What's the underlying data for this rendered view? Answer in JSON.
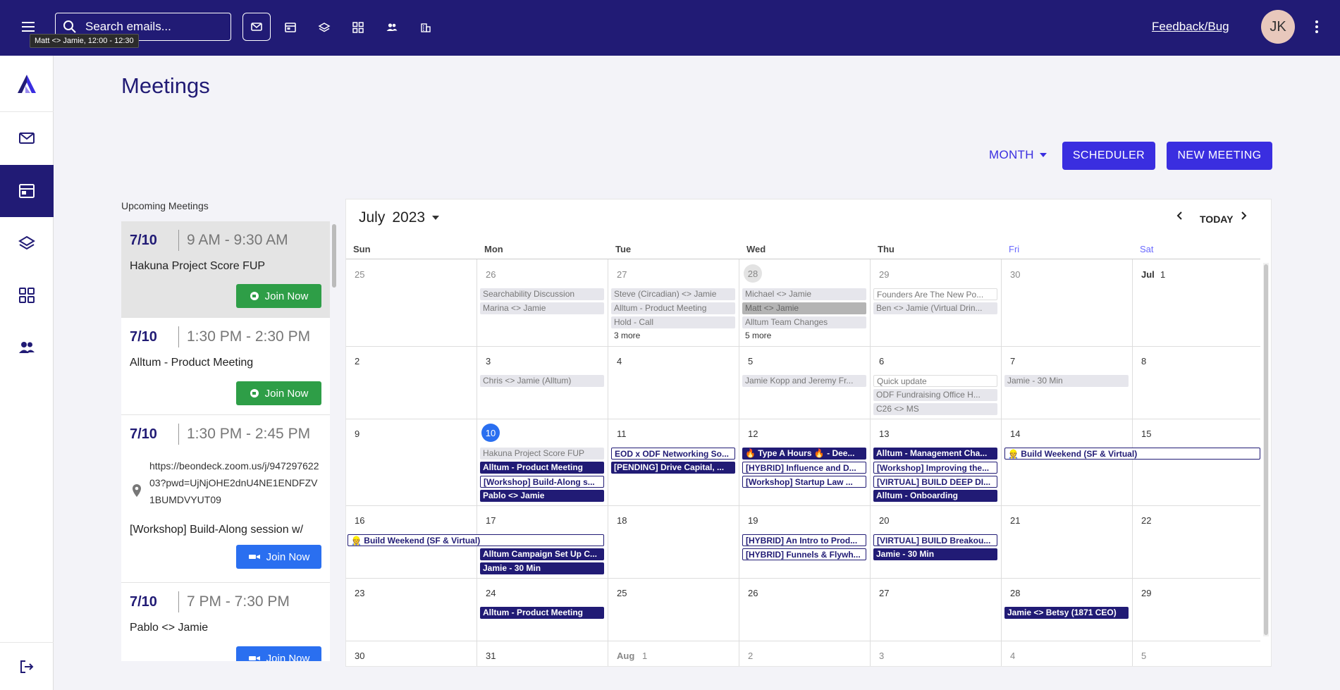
{
  "topbar": {
    "search_placeholder": "Search emails...",
    "tooltip": "Matt <> Jamie, 12:00 - 12:30",
    "feedback": "Feedback/Bug",
    "avatar_initials": "JK"
  },
  "page": {
    "title": "Meetings",
    "view_select": "MONTH",
    "scheduler_label": "SCHEDULER",
    "new_meeting_label": "NEW MEETING",
    "upcoming_label": "Upcoming Meetings"
  },
  "upcoming": [
    {
      "date": "7/10",
      "time": "9 AM - 9:30 AM",
      "title": "Hakuna Project Score FUP",
      "join": "Join Now",
      "platform": "meet"
    },
    {
      "date": "7/10",
      "time": "1:30 PM - 2:30 PM",
      "title": "Alltum - Product Meeting",
      "join": "Join Now",
      "platform": "meet"
    },
    {
      "date": "7/10",
      "time": "1:30 PM - 2:45 PM",
      "location": "https://beondeck.zoom.us/j/94729762203?pwd=UjNjOHE2dnU4NE1ENDFZV1BUMDVYUT09",
      "title": "[Workshop] Build-Along session w/",
      "join": "Join Now",
      "platform": "zoom"
    },
    {
      "date": "7/10",
      "time": "7 PM - 7:30 PM",
      "title": "Pablo <> Jamie",
      "join": "Join Now",
      "platform": "zoom"
    }
  ],
  "calendar": {
    "month": "July",
    "year": "2023",
    "today_label": "TODAY",
    "days_of_week": [
      "Sun",
      "Mon",
      "Tue",
      "Wed",
      "Thu",
      "Fri",
      "Sat"
    ],
    "weeks": [
      [
        "25",
        "26",
        "27",
        "28",
        "29",
        "30",
        "1"
      ],
      [
        "2",
        "3",
        "4",
        "5",
        "6",
        "7",
        "8"
      ],
      [
        "9",
        "10",
        "11",
        "12",
        "13",
        "14",
        "15"
      ],
      [
        "16",
        "17",
        "18",
        "19",
        "20",
        "21",
        "22"
      ],
      [
        "23",
        "24",
        "25",
        "26",
        "27",
        "28",
        "29"
      ],
      [
        "30",
        "31",
        "1",
        "2",
        "3",
        "4",
        "5"
      ]
    ],
    "month_markers": {
      "jul": "Jul",
      "aug": "Aug"
    },
    "events": {
      "w0": {
        "mon": [
          "Searchability Discussion",
          "Marina <> Jamie"
        ],
        "tue": [
          "Steve (Circadian) <> Jamie",
          "Alltum - Product Meeting",
          "Hold - Call"
        ],
        "tue_more": "3 more",
        "wed": [
          "Michael <> Jamie",
          "Matt <> Jamie",
          "Alltum Team Changes"
        ],
        "wed_more": "5 more",
        "thu": [
          "Founders Are The New Po...",
          "Ben <> Jamie (Virtual Drin..."
        ]
      },
      "w1": {
        "mon": [
          "Chris <> Jamie (Alltum)"
        ],
        "wed": [
          "Jamie Kopp and Jeremy Fr..."
        ],
        "thu": [
          "Quick update",
          "ODF Fundraising Office H...",
          "C26 <> MS"
        ],
        "fri": [
          "Jamie - 30 Min"
        ]
      },
      "w2": {
        "mon": [
          "Hakuna Project Score FUP",
          "Alltum - Product Meeting",
          "[Workshop] Build-Along s...",
          "Pablo <> Jamie"
        ],
        "tue": [
          "EOD x ODF Networking So...",
          "[PENDING] Drive Capital, ..."
        ],
        "wed": [
          "🔥 Type A Hours 🔥 - Dee...",
          "[HYBRID] Influence and D...",
          "[Workshop] Startup Law ..."
        ],
        "thu": [
          "Alltum - Management Cha...",
          "[Workshop] Improving the...",
          "[VIRTUAL] BUILD DEEP DI...",
          "Alltum - Onboarding"
        ],
        "fri_sat": "👷 Build Weekend (SF & Virtual)"
      },
      "w3": {
        "sun": "👷 Build Weekend (SF & Virtual)",
        "mon": [
          "Alltum Campaign Set Up C...",
          "Jamie - 30 Min"
        ],
        "wed": [
          "[HYBRID] An Intro to Prod...",
          "[HYBRID] Funnels & Flywh..."
        ],
        "thu": [
          "[VIRTUAL] BUILD Breakou...",
          "Jamie - 30 Min"
        ]
      },
      "w4": {
        "mon": [
          "Alltum - Product Meeting"
        ],
        "fri": [
          "Jamie <> Betsy (1871 CEO)"
        ]
      }
    }
  },
  "colors": {
    "primary_dark": "#211b75",
    "accent": "#3a2ee0",
    "join_green": "#2e9e47",
    "join_blue": "#2a6ff0"
  }
}
